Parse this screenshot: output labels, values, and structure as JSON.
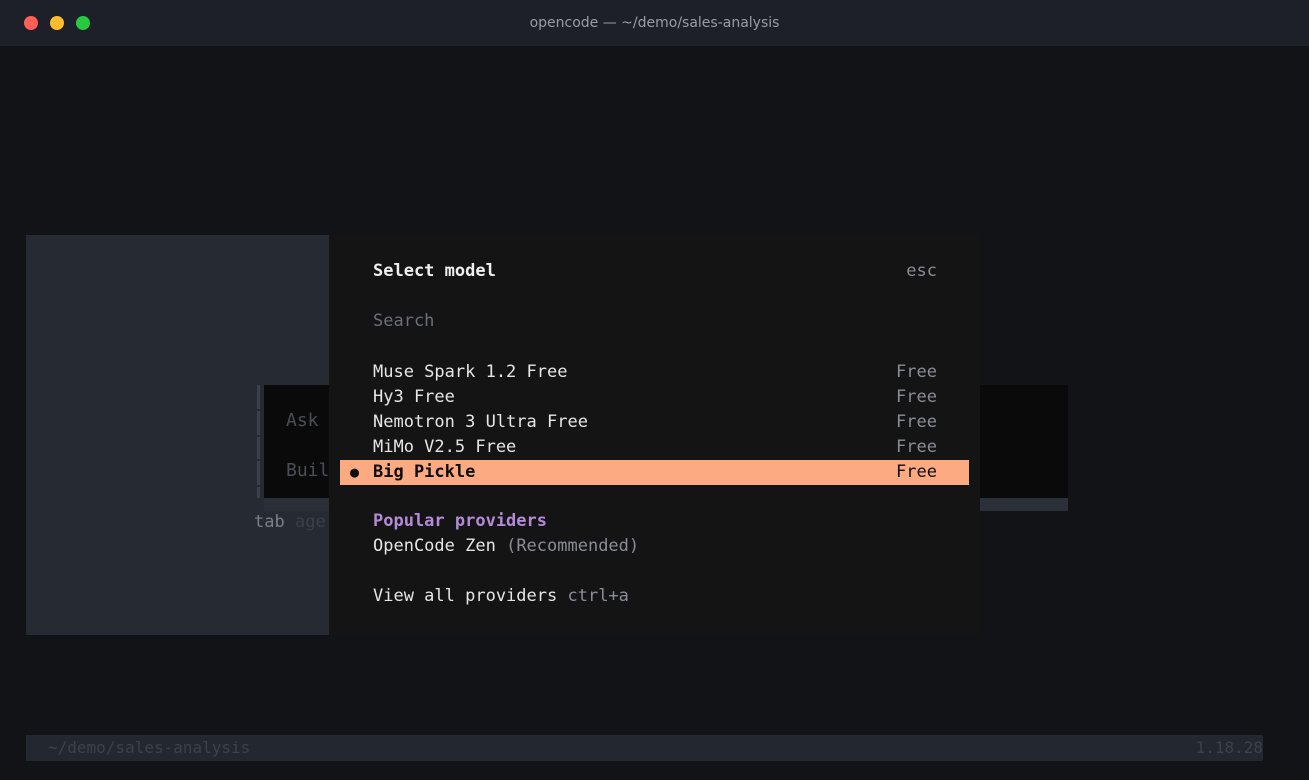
{
  "window": {
    "title": "opencode — ~/demo/sales-analysis"
  },
  "background": {
    "line1": "Ask",
    "line2": "Buil",
    "tab_key": "tab",
    "tab_label": "age"
  },
  "modal": {
    "title": "Select model",
    "close_hint": "esc",
    "search_placeholder": "Search",
    "models": [
      {
        "name": "Muse Spark 1.2 Free",
        "price": "Free",
        "selected": false
      },
      {
        "name": "Hy3 Free",
        "price": "Free",
        "selected": false
      },
      {
        "name": "Nemotron 3 Ultra Free",
        "price": "Free",
        "selected": false
      },
      {
        "name": "MiMo V2.5 Free",
        "price": "Free",
        "selected": false
      },
      {
        "name": "Big Pickle",
        "price": "Free",
        "selected": true
      }
    ],
    "selected_marker": "●",
    "popular_heading": "Popular providers",
    "provider_name": "OpenCode Zen",
    "provider_note": "(Recommended)",
    "view_all_label": "View all providers",
    "view_all_shortcut": "ctrl+a"
  },
  "statusbar": {
    "path": "~/demo/sales-analysis",
    "version": "1.18.28"
  },
  "colors": {
    "accent_selected": "#fbaa81",
    "heading_purple": "#b48ad9"
  }
}
